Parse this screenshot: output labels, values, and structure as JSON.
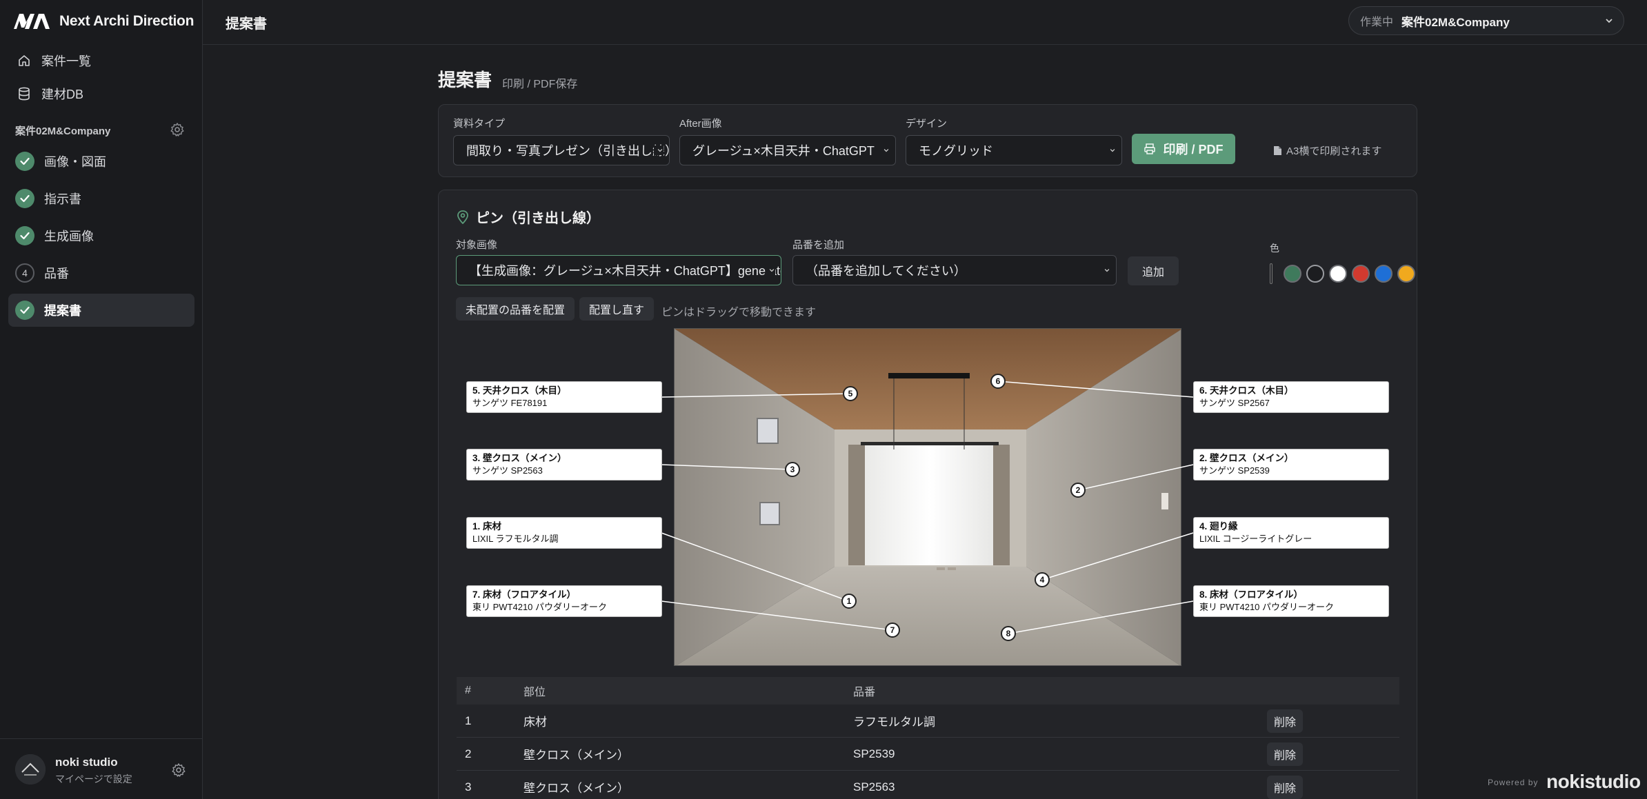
{
  "app": {
    "logo_text": "Next Archi Direction"
  },
  "sidebar": {
    "nav": [
      {
        "label": "案件一覧",
        "icon": "home-icon"
      },
      {
        "label": "建材DB",
        "icon": "database-icon"
      }
    ],
    "project_label": "案件02M&Company",
    "steps": [
      {
        "label": "画像・図面",
        "state": "done"
      },
      {
        "label": "指示書",
        "state": "done"
      },
      {
        "label": "生成画像",
        "state": "done"
      },
      {
        "label": "品番",
        "state": "number",
        "number": "4"
      },
      {
        "label": "提案書",
        "state": "done",
        "active": true
      }
    ],
    "user": {
      "name": "noki studio",
      "sub": "マイページで設定"
    }
  },
  "header": {
    "title": "提案書",
    "project_select": {
      "label": "作業中",
      "value": "案件02M&Company"
    }
  },
  "main": {
    "title": "提案書",
    "subtitle": "印刷 / PDF保存",
    "controls": {
      "doc_type_label": "資料タイプ",
      "doc_type_value": "間取り・写真プレゼン（引き出し線）",
      "after_label": "After画像",
      "after_value": "グレージュ×木目天井・ChatGPT",
      "design_label": "デザイン",
      "design_value": "モノグリッド",
      "print_button": "印刷 / PDF",
      "note": "A3横で印刷されます"
    },
    "pins": {
      "title": "ピン（引き出し線）",
      "target_label": "対象画像",
      "target_value": "【生成画像：グレージュ×木目天井・ChatGPT】generated",
      "add_label": "品番を追加",
      "add_placeholder": "（品番を追加してください）",
      "add_button": "追加",
      "color_label": "色",
      "colors": [
        "#3f7a5c",
        "#1c1d20",
        "#ffffff",
        "#d23a2f",
        "#1e6fd6",
        "#f0a91e"
      ],
      "place_button": "未配置の品番を配置",
      "replace_button": "配置し直す",
      "hint": "ピンはドラッグで移動できます"
    },
    "labels": [
      {
        "num": "5",
        "title": "5. 天井クロス（木目）",
        "sub": "サンゲツ FE78191"
      },
      {
        "num": "3",
        "title": "3. 壁クロス（メイン）",
        "sub": "サンゲツ SP2563"
      },
      {
        "num": "1",
        "title": "1. 床材",
        "sub": "LIXIL ラフモルタル調"
      },
      {
        "num": "7",
        "title": "7. 床材（フロアタイル）",
        "sub": "東リ PWT4210 パウダリーオーク"
      },
      {
        "num": "6",
        "title": "6. 天井クロス（木目）",
        "sub": "サンゲツ SP2567"
      },
      {
        "num": "2",
        "title": "2. 壁クロス（メイン）",
        "sub": "サンゲツ SP2539"
      },
      {
        "num": "4",
        "title": "4. 廻り縁",
        "sub": "LIXIL コージーライトグレー"
      },
      {
        "num": "8",
        "title": "8. 床材（フロアタイル）",
        "sub": "東リ PWT4210 パウダリーオーク"
      }
    ],
    "table": {
      "headers": [
        "#",
        "部位",
        "品番",
        ""
      ],
      "rows": [
        {
          "no": "1",
          "part": "床材",
          "code": "ラフモルタル調",
          "action": "削除"
        },
        {
          "no": "2",
          "part": "壁クロス（メイン）",
          "code": "SP2539",
          "action": "削除"
        },
        {
          "no": "3",
          "part": "壁クロス（メイン）",
          "code": "SP2563",
          "action": "削除"
        }
      ]
    }
  },
  "footer": {
    "powered": "Powered by",
    "brand": "nokistudio"
  }
}
